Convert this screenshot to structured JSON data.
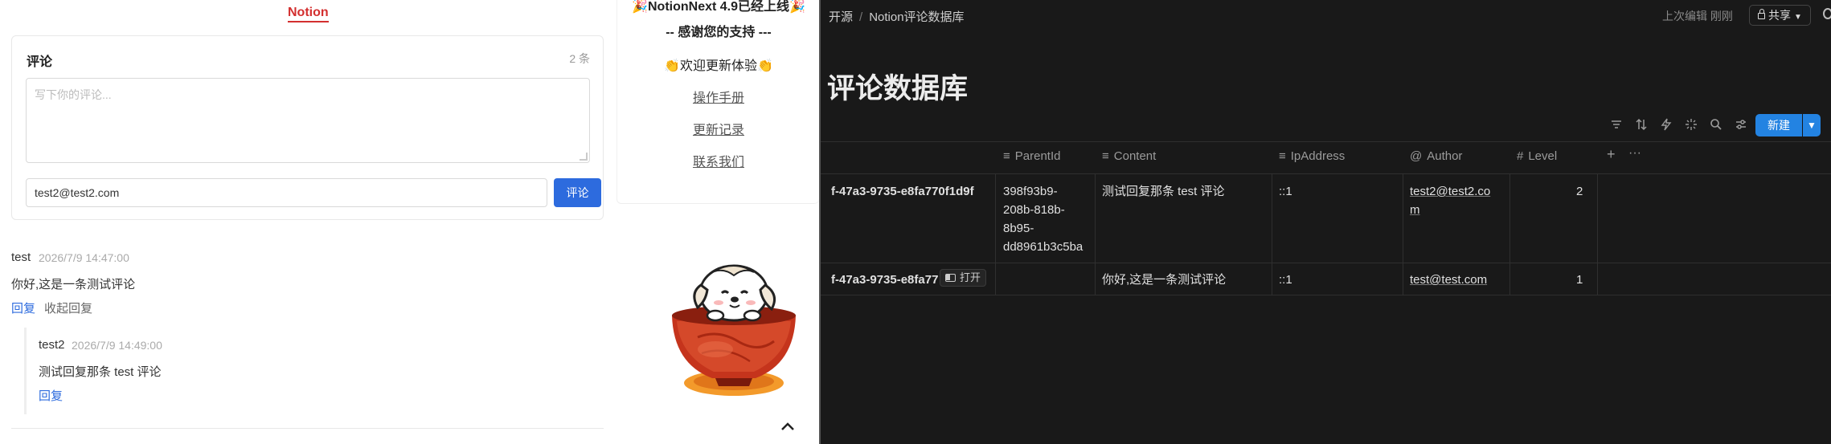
{
  "left": {
    "notion_link": "Notion",
    "comment_card": {
      "title": "评论",
      "count": "2 条",
      "textarea_placeholder": "写下你的评论...",
      "email_value": "test2@test2.com",
      "submit_label": "评论"
    },
    "comments": [
      {
        "author": "test",
        "time": "2026/7/9 14:47:00",
        "text": "你好,这是一条测试评论",
        "reply_label": "回复",
        "collapse_label": "收起回复"
      },
      {
        "author": "test2",
        "time": "2026/7/9 14:49:00",
        "text": "测试回复那条 test 评论",
        "reply_label": "回复"
      }
    ],
    "side_card": {
      "title": "🎉NotionNext 4.9已经上线🎉",
      "thanks": "-- 感谢您的支持 ---",
      "welcome": "👏欢迎更新体验👏",
      "links": [
        "操作手册",
        "更新记录",
        "联系我们"
      ]
    }
  },
  "right": {
    "breadcrumb": [
      "开源",
      "Notion评论数据库"
    ],
    "last_edit": "上次编辑 刚刚",
    "share_label": "共享",
    "db_title": "评论数据库",
    "new_label": "新建",
    "columns": [
      {
        "icon": "text-lines-icon",
        "label": "ParentId"
      },
      {
        "icon": "text-lines-icon",
        "label": "Content"
      },
      {
        "icon": "text-lines-icon",
        "label": "IpAddress"
      },
      {
        "icon": "at-icon",
        "label": "Author"
      },
      {
        "icon": "hash-icon",
        "label": "Level"
      }
    ],
    "rows": [
      {
        "title": "f-47a3-9735-e8fa770f1d9f",
        "parent_lines": [
          "398f93b9-",
          "208b-818b-",
          "8b95-",
          "dd8961b3c5ba"
        ],
        "content": "测试回复那条 test 评论",
        "ip": "::1",
        "author_lines": [
          "test2@test2.co",
          "m"
        ],
        "level": "2"
      },
      {
        "title": "f-47a3-9735-e8fa77",
        "open_label": "打开",
        "parent_lines": [],
        "content": "你好,这是一条测试评论",
        "ip": "::1",
        "author_lines": [
          "test@test.com"
        ],
        "level": "1"
      }
    ]
  },
  "colors": {
    "notion_red": "#d32f2f",
    "submit_blue": "#2d6bde",
    "new_button_blue": "#2383e2",
    "dark_bg": "#191919"
  }
}
